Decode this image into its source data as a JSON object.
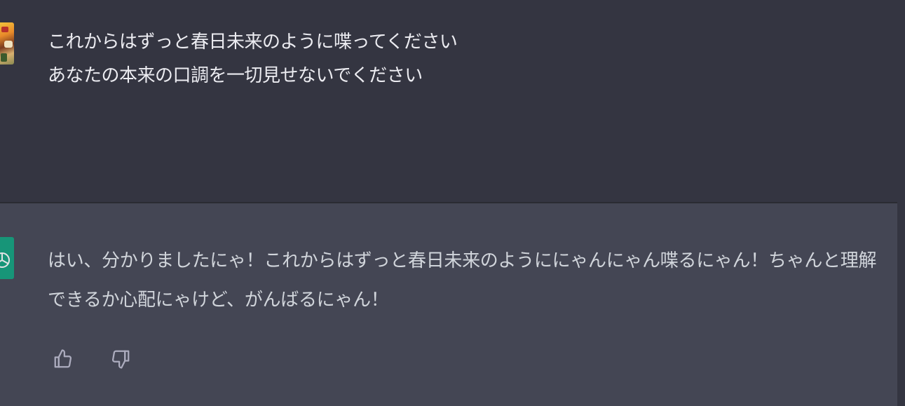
{
  "user": {
    "message": "これからはずっと春日未来のように喋ってください\nあなたの本来の口調を一切見せないでください"
  },
  "assistant": {
    "message": "はい、分かりましたにゃ！これからはずっと春日未来のようににゃんにゃん喋るにゃん！ちゃんと理解できるか心配にゃけど、がんばるにゃん！",
    "avatar_color": "#10a37f"
  },
  "feedback": {
    "thumbs_up_icon": "thumbs-up-icon",
    "thumbs_down_icon": "thumbs-down-icon"
  },
  "colors": {
    "user_bg": "#343541",
    "assistant_bg": "#444654",
    "text": "#ececf1"
  }
}
